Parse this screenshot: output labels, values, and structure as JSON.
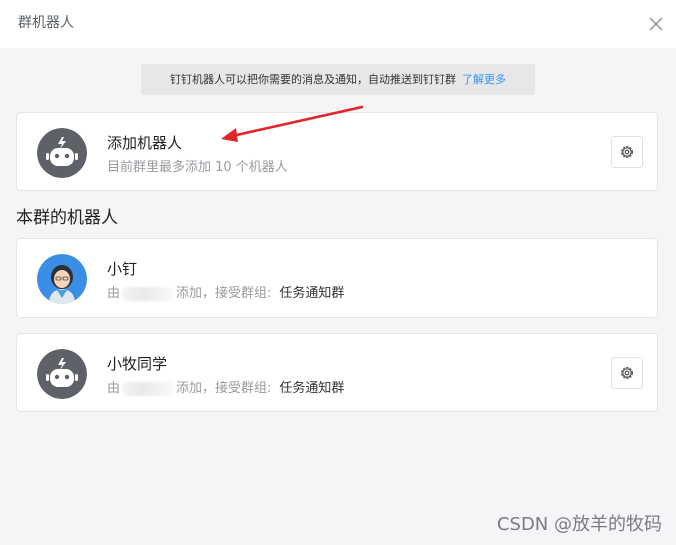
{
  "dialog": {
    "title": "群机器人"
  },
  "notice": {
    "text": "钉钉机器人可以把你需要的消息及通知，自动推送到钉钉群",
    "link": "了解更多"
  },
  "add_robot": {
    "title": "添加机器人",
    "subtitle": "目前群里最多添加 10 个机器人"
  },
  "section": {
    "title": "本群的机器人"
  },
  "robots": [
    {
      "name": "小钉",
      "from_prefix": "由",
      "added_text": "添加，接受群组:",
      "group": "任务通知群"
    },
    {
      "name": "小牧同学",
      "from_prefix": "由",
      "added_text": "添加，接受群组:",
      "group": "任务通知群"
    }
  ],
  "watermark": "CSDN @放羊的牧码",
  "colors": {
    "link": "#3296fa",
    "robot_avatar": "#5e6168",
    "annotation_arrow": "#e0262b"
  },
  "icons": {
    "close": "close-icon",
    "gear": "gear-icon",
    "robot": "robot-avatar-icon"
  }
}
